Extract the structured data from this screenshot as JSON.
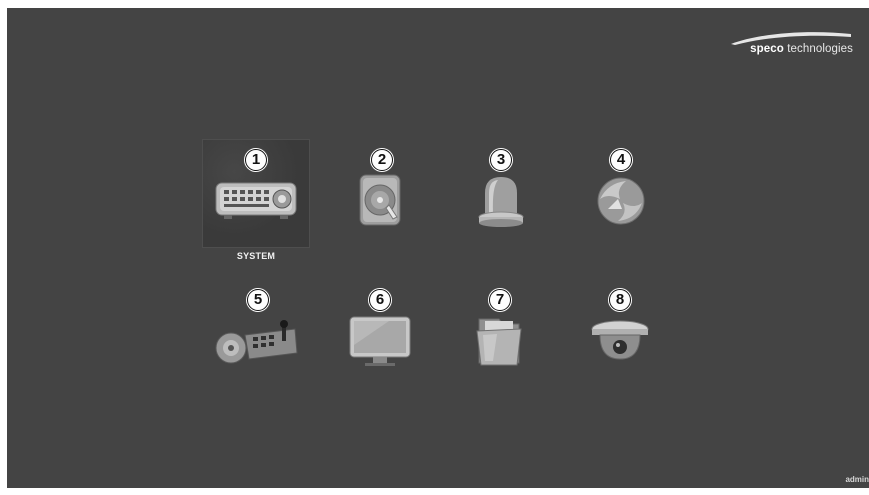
{
  "brand": {
    "bold": "speco",
    "rest": " technologies"
  },
  "menu": {
    "items": [
      {
        "num": "1",
        "name": "system",
        "icon": "dvr-recorder-icon",
        "label": "SYSTEM",
        "selected": true
      },
      {
        "num": "2",
        "name": "storage",
        "icon": "hard-disk-icon"
      },
      {
        "num": "3",
        "name": "alarm",
        "icon": "alarm-beacon-icon"
      },
      {
        "num": "4",
        "name": "network",
        "icon": "network-globe-icon"
      },
      {
        "num": "5",
        "name": "ptz-control",
        "icon": "ptz-keyboard-camera-icon"
      },
      {
        "num": "6",
        "name": "display",
        "icon": "monitor-icon"
      },
      {
        "num": "7",
        "name": "archive",
        "icon": "folder-icon"
      },
      {
        "num": "8",
        "name": "camera",
        "icon": "dome-camera-icon"
      }
    ]
  },
  "status": {
    "user": "admin"
  },
  "colors": {
    "background": "#444444",
    "badge": "#ffffff"
  }
}
